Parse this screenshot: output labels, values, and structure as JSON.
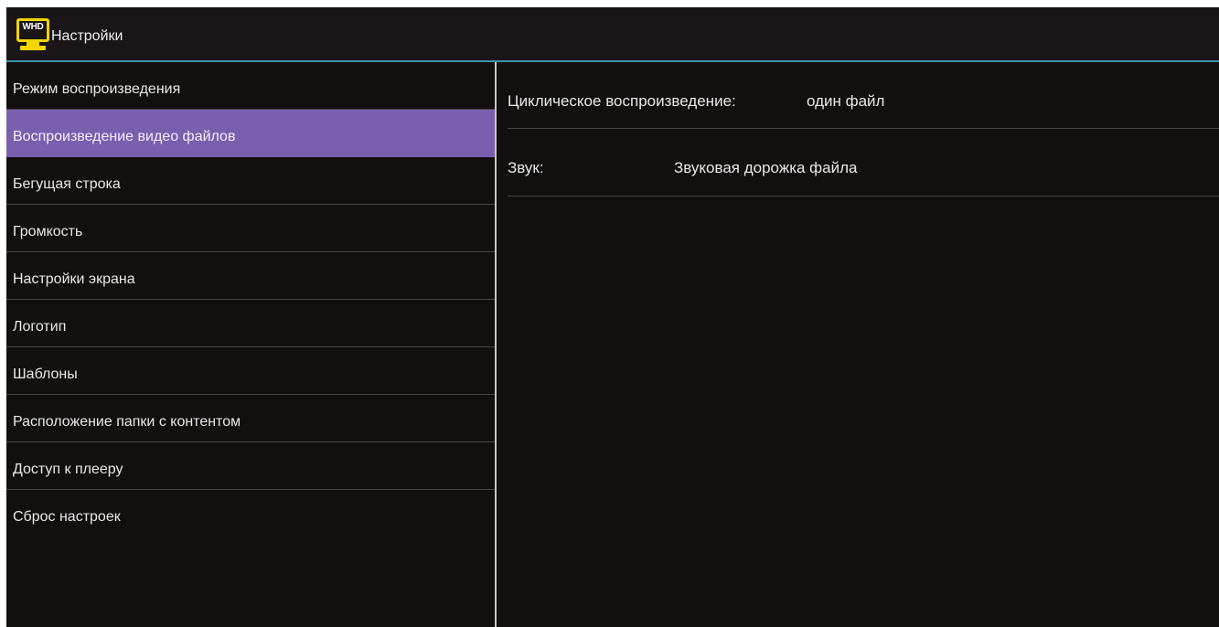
{
  "header": {
    "logo_text": "WHD",
    "title": "Настройки"
  },
  "sidebar": {
    "selected_index": 1,
    "items": [
      {
        "label": "Режим воспроизведения"
      },
      {
        "label": "Воспроизведение видео файлов"
      },
      {
        "label": "Бегущая строка"
      },
      {
        "label": "Громкость"
      },
      {
        "label": "Настройки экрана"
      },
      {
        "label": "Логотип"
      },
      {
        "label": "Шаблоны"
      },
      {
        "label": "Расположение папки с контентом"
      },
      {
        "label": "Доступ к плееру"
      },
      {
        "label": "Сброс настроек"
      }
    ]
  },
  "settings": {
    "loop": {
      "label": "Циклическое воспроизведение:",
      "value": "один файл"
    },
    "sound": {
      "label": "Звук:",
      "value": "Звуковая дорожка файла"
    }
  },
  "colors": {
    "background": "#140f0f",
    "accent_line": "#3f94a8",
    "selection": "#7a5fae",
    "logo": "#f2d600"
  }
}
